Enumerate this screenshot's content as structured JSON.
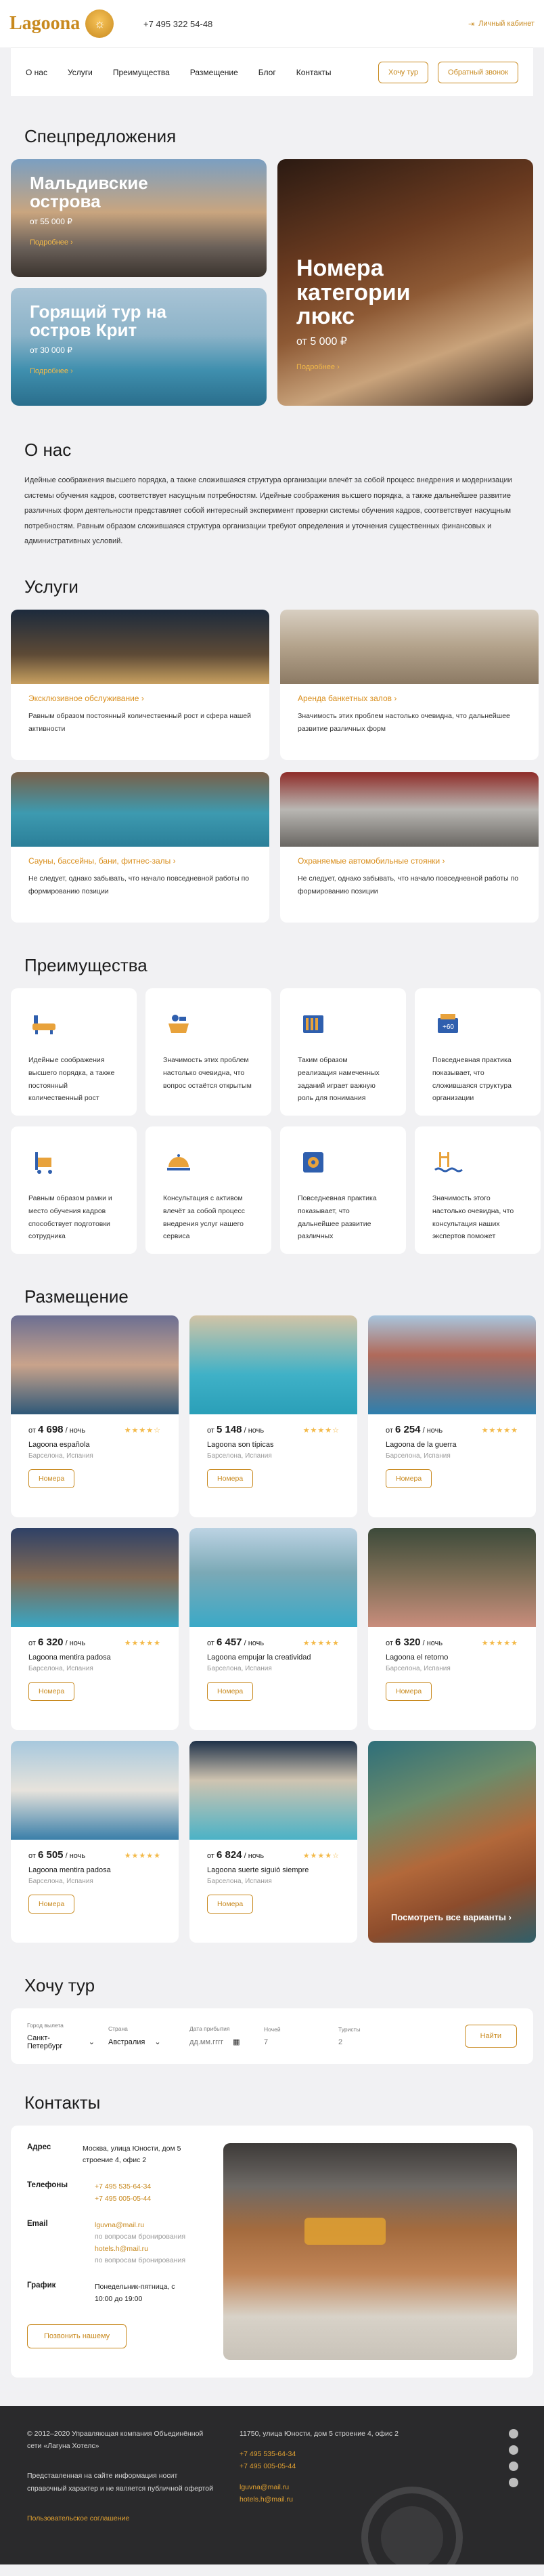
{
  "header": {
    "brand": "Lagoona",
    "phone": "+7 495 322 54-48",
    "cabinet": "Личный кабинет"
  },
  "nav": {
    "links": [
      "О нас",
      "Услуги",
      "Преимущества",
      "Размещение",
      "Блог",
      "Контакты"
    ],
    "tour_button": "Хочу тур",
    "callback_button": "Обратный звонок"
  },
  "specials": {
    "title": "Спецпредложения",
    "cards": [
      {
        "title": "Мальдивские острова",
        "price": "от 55 000 ₽",
        "more": "Подробнее"
      },
      {
        "title": "Горящий тур на остров Крит",
        "price": "от 30 000 ₽",
        "more": "Подробнее"
      },
      {
        "title": "Номера категории люкс",
        "price": "от 5 000 ₽",
        "more": "Подробнее"
      }
    ]
  },
  "about": {
    "title": "О нас",
    "text": "Идейные соображения высшего порядка, а также сложившаяся структура организации влечёт за собой процесс внедрения и модернизации системы обучения кадров, соответствует насущным потребностям. Идейные соображения высшего порядка, а также дальнейшее развитие различных форм деятельности представляет собой интересный эксперимент проверки системы обучения кадров, соответствует насущным потребностям. Равным образом сложившаяся структура организации требуют определения и уточнения существенных финансовых и административных условий."
  },
  "services": {
    "title": "Услуги",
    "items": [
      {
        "title": "Эксклюзивное обслуживание",
        "text": "Равным образом постоянный количественный рост и сфера нашей активности"
      },
      {
        "title": "Аренда банкетных залов",
        "text": "Значимость этих проблем настолько очевидна, что дальнейшее развитие различных форм"
      },
      {
        "title": "Сауны, бассейны, бани, фитнес-залы",
        "text": "Не следует, однако забывать, что начало повседневной работы по формированию позиции"
      },
      {
        "title": "Охраняемые автомобильные стоянки",
        "text": "Не следует, однако забывать, что начало повседневной работы по формированию позиции"
      }
    ]
  },
  "advantages": {
    "title": "Преимущества",
    "items": [
      {
        "icon": "bathtub-icon",
        "text": "Идейные соображения высшего порядка, а также постоянный количественный рост"
      },
      {
        "icon": "baby-bath-icon",
        "text": "Значимость этих проблем настолько очевидна, что вопрос остаётся открытым"
      },
      {
        "icon": "radiator-icon",
        "text": "Таким образом реализация намеченных заданий играет важную роль для понимания"
      },
      {
        "icon": "sauna-icon",
        "text": "Повседневная практика показывает, что сложившаяся структура организации"
      },
      {
        "icon": "bellboy-cart-icon",
        "text": "Равным образом рамки и место обучения кадров способствует подготовки сотрудника"
      },
      {
        "icon": "room-service-icon",
        "text": "Консультация с активом влечёт за собой процесс внедрения услуг нашего сервиса"
      },
      {
        "icon": "safe-icon",
        "text": "Повседневная практика показывает, что дальнейшее развитие различных"
      },
      {
        "icon": "pool-icon",
        "text": "Значимость этого настолько очевидна, что консультация наших экспертов поможет"
      }
    ]
  },
  "accommodation": {
    "title": "Размещение",
    "price_prefix": "от",
    "per_night": "/ ночь",
    "button": "Номера",
    "all_variants": "Посмотреть все варианты",
    "hotels": [
      {
        "price": "4 698",
        "stars": "★★★★☆",
        "name": "Lagoona española",
        "location": "Барселона, Испания"
      },
      {
        "price": "5 148",
        "stars": "★★★★☆",
        "name": "Lagoona son típicas",
        "location": "Барселона, Испания"
      },
      {
        "price": "6 254",
        "stars": "★★★★★",
        "name": "Lagoona de la guerra",
        "location": "Барселона, Испания"
      },
      {
        "price": "6 320",
        "stars": "★★★★★",
        "name": "Lagoona mentira padosa",
        "location": "Барселона, Испания"
      },
      {
        "price": "6 457",
        "stars": "★★★★★",
        "name": "Lagoona empujar la creatividad",
        "location": "Барселона, Испания"
      },
      {
        "price": "6 320",
        "stars": "★★★★★",
        "name": "Lagoona el retorno",
        "location": "Барселона, Испания"
      },
      {
        "price": "6 505",
        "stars": "★★★★★",
        "name": "Lagoona mentira padosa",
        "location": "Барселона, Испания"
      },
      {
        "price": "6 824",
        "stars": "★★★★☆",
        "name": "Lagoona suerte siguió siempre",
        "location": "Барселона, Испания"
      }
    ]
  },
  "tour_search": {
    "title": "Хочу тур",
    "fields": [
      {
        "label": "Город вылета",
        "value": "Санкт-Петербург"
      },
      {
        "label": "Страна",
        "value": "Австралия"
      },
      {
        "label": "Дата прибытия",
        "value": "дд.мм.гггг"
      },
      {
        "label": "Ночей",
        "value": "7"
      },
      {
        "label": "Туристы",
        "value": "2"
      }
    ],
    "button": "Найти"
  },
  "contacts": {
    "title": "Контакты",
    "address_label": "Адрес",
    "address": "Москва, улица Юности, дом 5 строение 4, офис 2",
    "phones_label": "Телефоны",
    "phone1": "+7 495 535-64-34",
    "phone2": "+7 495 005-05-44",
    "email_label": "Email",
    "email1": "lguvna@mail.ru",
    "email1_note": "по вопросам бронирования",
    "email2": "hotels.h@mail.ru",
    "email2_note": "по вопросам бронирования",
    "schedule_label": "График",
    "schedule": "Понедельник-пятница, с 10:00 до 19:00",
    "button": "Позвонить нашему"
  },
  "footer": {
    "copyright": "© 2012–2020 Управляющая компания Объединённой сети «Лагуна Хотелс»",
    "disclaimer": "Представленная на сайте информация носит справочный характер и не является публичной офертой",
    "policy": "Пользовательское соглашение",
    "address": "11750, улица Юности, дом 5 строение 4, офис 2",
    "phone1": "+7 495 535-64-34",
    "phone2": "+7 495 005-05-44",
    "email1": "lguvna@mail.ru",
    "email2": "hotels.h@mail.ru"
  }
}
